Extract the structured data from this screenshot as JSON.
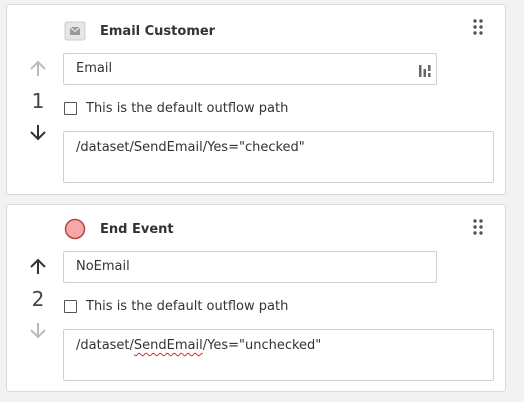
{
  "steps": [
    {
      "number": "1",
      "title": "Email Customer",
      "icon": "envelope-icon",
      "name_value": "Email",
      "default_label": "This is the default outflow path",
      "condition_prefix": "/dataset/SendEmail/Yes=\"checked\"",
      "up_enabled": false,
      "down_enabled": true
    },
    {
      "number": "2",
      "title": "End Event",
      "icon": "end-event-circle-icon",
      "name_value": "NoEmail",
      "default_label": "This is the default outflow path",
      "condition_part1": "/dataset/",
      "condition_misspelled": "SendEmail",
      "condition_part2": "/Yes=\"unchecked\"",
      "up_enabled": true,
      "down_enabled": false
    }
  ],
  "colors": {
    "end_event_fill": "#f4a9a8",
    "end_event_stroke": "#b34747",
    "arrow_enabled": "#333333",
    "arrow_disabled": "#bbbbbb",
    "spellcheck": "#d0312d"
  }
}
